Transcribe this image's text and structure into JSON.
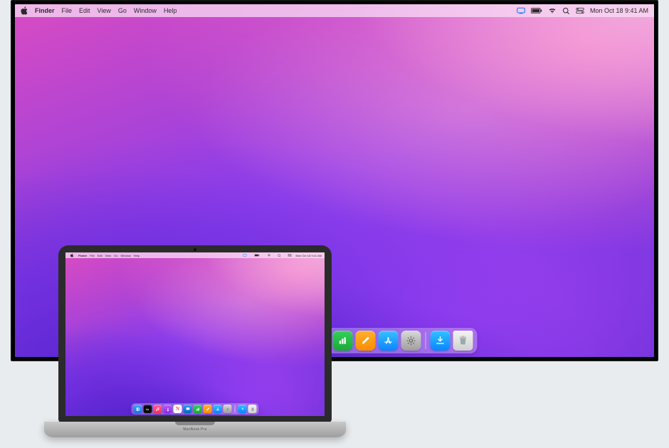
{
  "hardware": {
    "laptop_model_label": "MacBook Pro"
  },
  "menubar": {
    "app_name": "Finder",
    "menus": [
      "File",
      "Edit",
      "View",
      "Go",
      "Window",
      "Help"
    ],
    "datetime": "Mon Oct 18  9:41 AM"
  },
  "dock": {
    "apps": [
      {
        "id": "finder",
        "label": "Finder"
      },
      {
        "id": "tv",
        "label": "TV",
        "glyph": "tv"
      },
      {
        "id": "music",
        "label": "Music"
      },
      {
        "id": "podcasts",
        "label": "Podcasts"
      },
      {
        "id": "news",
        "label": "News",
        "glyph": "N"
      },
      {
        "id": "keynote",
        "label": "Keynote"
      },
      {
        "id": "numbers",
        "label": "Numbers"
      },
      {
        "id": "pages",
        "label": "Pages"
      },
      {
        "id": "appstore",
        "label": "App Store"
      },
      {
        "id": "settings",
        "label": "System Preferences"
      }
    ],
    "right": [
      {
        "id": "downloads",
        "label": "Downloads"
      },
      {
        "id": "trash",
        "label": "Trash"
      }
    ]
  },
  "status_icons": [
    "display-mirror",
    "battery",
    "wifi",
    "spotlight",
    "control-center"
  ]
}
